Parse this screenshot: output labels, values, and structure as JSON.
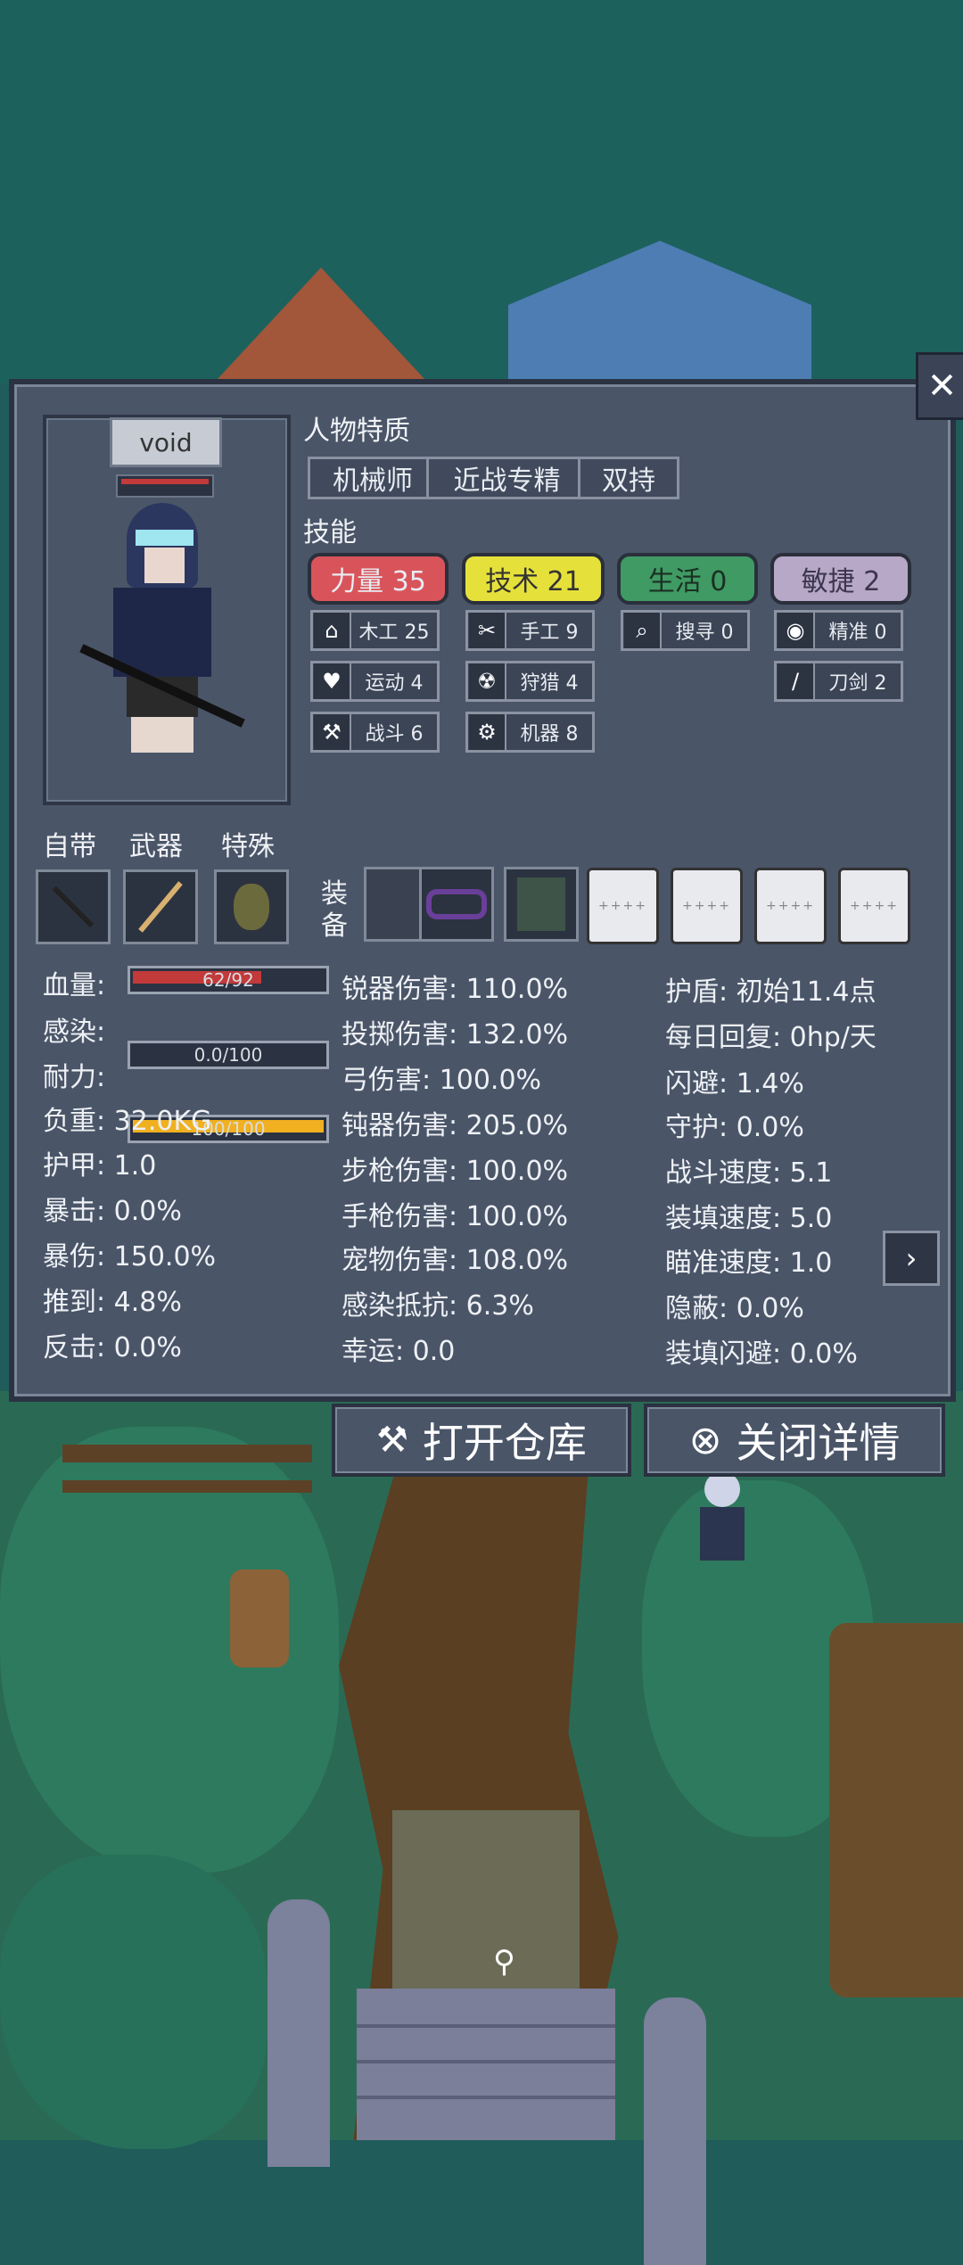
{
  "character": {
    "name": "void"
  },
  "traits": {
    "title": "人物特质",
    "items": [
      "机械师",
      "近战专精",
      "双持"
    ]
  },
  "skills": {
    "title": "技能",
    "attributes": [
      {
        "label": "力量 35",
        "color": "#d9545a"
      },
      {
        "label": "技术 21",
        "color": "#e6e13a"
      },
      {
        "label": "生活 0",
        "color": "#3f9a63"
      },
      {
        "label": "敏捷 2",
        "color": "#b6a8c6"
      }
    ],
    "col1": [
      {
        "icon": "house-icon",
        "glyph": "⌂",
        "label": "木工 25"
      },
      {
        "icon": "heart-icon",
        "glyph": "♥",
        "label": "运动 4"
      },
      {
        "icon": "axe-icon",
        "glyph": "⚒",
        "label": "战斗 6"
      }
    ],
    "col2": [
      {
        "icon": "scissors-icon",
        "glyph": "✂",
        "label": "手工 9"
      },
      {
        "icon": "radiation-icon",
        "glyph": "☢",
        "label": "狩猎 4"
      },
      {
        "icon": "gear-icon",
        "glyph": "⚙",
        "label": "机器 8"
      }
    ],
    "col3": [
      {
        "icon": "magnifier-icon",
        "glyph": "⌕",
        "label": "搜寻 0"
      }
    ],
    "col4": [
      {
        "icon": "eye-icon",
        "glyph": "◉",
        "label": "精准 0"
      },
      {
        "icon": "knife-icon",
        "glyph": "/",
        "label": "刀剑 2"
      }
    ]
  },
  "loadout": {
    "innate": "自带",
    "weapon": "武器",
    "special": "特殊",
    "equipment": "装备"
  },
  "stats_left": {
    "hp_label": "血量:",
    "hp_text": "62/92",
    "hp_fraction": 0.674,
    "infection_label": "感染:",
    "infection_text": "0.0/100",
    "infection_fraction": 0.0,
    "stamina_label": "耐力:",
    "stamina_text": "100/100",
    "stamina_fraction": 1.0,
    "lines": [
      "负重: 32.0KG",
      "护甲: 1.0",
      "暴击: 0.0%",
      "暴伤: 150.0%",
      "推到: 4.8%",
      "反击: 0.0%"
    ]
  },
  "stats_mid": [
    "锐器伤害: 110.0%",
    "投掷伤害: 132.0%",
    "弓伤害: 100.0%",
    "钝器伤害: 205.0%",
    "步枪伤害: 100.0%",
    "手枪伤害: 100.0%",
    "宠物伤害: 108.0%",
    "感染抵抗: 6.3%",
    "幸运: 0.0"
  ],
  "stats_right": [
    "护盾: 初始11.4点",
    "每日回复: 0hp/天",
    "闪避: 1.4%",
    "守护: 0.0%",
    "战斗速度: 5.1",
    "装填速度: 5.0",
    "瞄准速度: 1.0",
    "隐蔽: 0.0%",
    "装填闪避: 0.0%"
  ],
  "buttons": {
    "open_storage": "打开仓库",
    "close_details": "关闭详情"
  },
  "colors": {
    "hp": "#c23a3a",
    "stamina": "#f0b020",
    "panel": "#4a5568"
  }
}
